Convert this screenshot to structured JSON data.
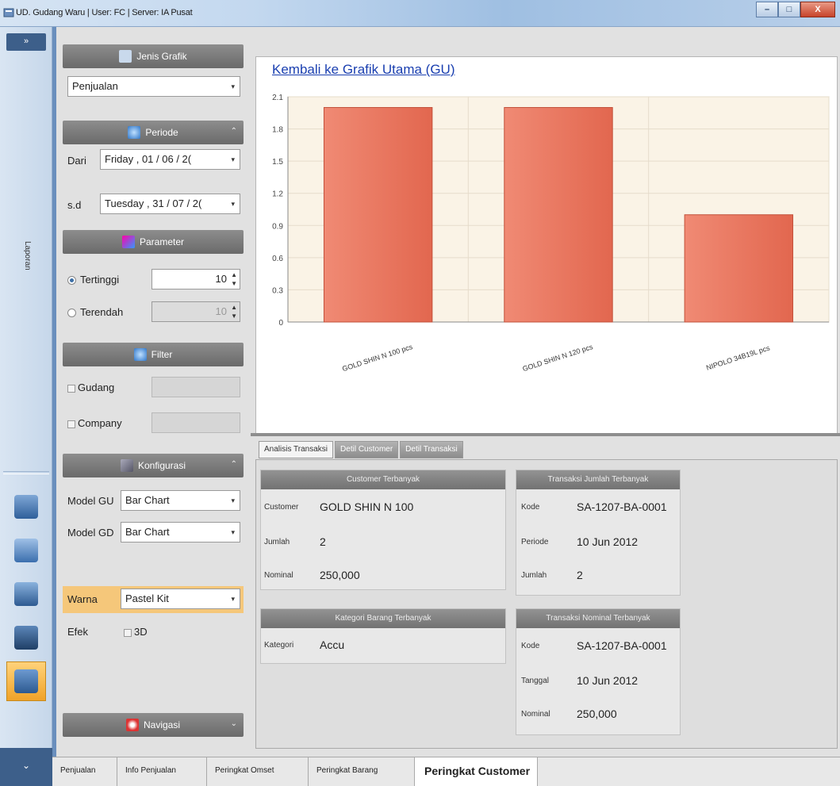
{
  "window": {
    "title": "UD. Gudang Waru  |  User: FC  |  Server: IA Pusat",
    "minimize": "–",
    "maximize": "□",
    "close": "X"
  },
  "leftbar": {
    "top_label": "»",
    "section_label": "Laporan",
    "bottom_label": "⌄",
    "icons": [
      "cash-register-icon",
      "globe-doc-icon",
      "briefcase-icon",
      "folder-icon",
      "report-user-icon"
    ]
  },
  "side": {
    "jenis_grafik": {
      "header": "Jenis Grafik",
      "value": "Penjualan"
    },
    "periode": {
      "header": "Periode",
      "dari_label": "Dari",
      "dari_value": "Friday   , 01 / 06 / 2(",
      "sd_label": "s.d",
      "sd_value": "Tuesday  , 31 / 07 / 2("
    },
    "parameter": {
      "header": "Parameter",
      "tertinggi_label": "Tertinggi",
      "tertinggi_value": "10",
      "terendah_label": "Terendah",
      "terendah_value": "10"
    },
    "filter": {
      "header": "Filter",
      "gudang_label": "Gudang",
      "company_label": "Company"
    },
    "konfigurasi": {
      "header": "Konfigurasi",
      "model_gu_label": "Model GU",
      "model_gu_value": "Bar Chart",
      "model_gd_label": "Model GD",
      "model_gd_value": "Bar Chart",
      "warna_label": "Warna",
      "warna_value": "Pastel Kit",
      "efek_label": "Efek",
      "efek_3d_label": "3D"
    },
    "navigasi": {
      "header": "Navigasi"
    }
  },
  "main": {
    "back_link": "Kembali ke Grafik Utama (GU)",
    "tabs": [
      "Analisis Transaksi",
      "Detil Customer",
      "Detil Transaksi"
    ],
    "cards": {
      "customer_terbanyak": {
        "header": "Customer Terbanyak",
        "rows": [
          {
            "key": "Customer",
            "value": "GOLD SHIN N 100"
          },
          {
            "key": "Jumlah",
            "value": "2"
          },
          {
            "key": "Nominal",
            "value": "250,000"
          }
        ]
      },
      "transaksi_jumlah": {
        "header": "Transaksi Jumlah Terbanyak",
        "rows": [
          {
            "key": "Kode",
            "value": "SA-1207-BA-0001"
          },
          {
            "key": "Periode",
            "value": "10 Jun 2012"
          },
          {
            "key": "Jumlah",
            "value": "2"
          }
        ]
      },
      "kategori_barang": {
        "header": "Kategori Barang Terbanyak",
        "rows": [
          {
            "key": "Kategori",
            "value": "Accu"
          }
        ]
      },
      "transaksi_nominal": {
        "header": "Transaksi Nominal Terbanyak",
        "rows": [
          {
            "key": "Kode",
            "value": "SA-1207-BA-0001"
          },
          {
            "key": "Tanggal",
            "value": "10 Jun 2012"
          },
          {
            "key": "Nominal",
            "value": "250,000"
          }
        ]
      }
    }
  },
  "bottom_tabs": [
    "Penjualan",
    "Info Penjualan",
    "Peringkat Omset",
    "Peringkat Barang",
    "Peringkat Customer"
  ],
  "colors": {
    "bar": "#e2674f",
    "bar_light": "#f08a74",
    "plot_bg": "#faf3e6",
    "link": "#1a3fb0"
  },
  "chart_data": {
    "type": "bar",
    "categories": [
      "GOLD SHIN N 100 pcs",
      "GOLD SHIN N 120 pcs",
      "NIPOLO 34B19L pcs"
    ],
    "values": [
      2,
      2,
      1
    ],
    "yticks": [
      "0",
      "0.3",
      "0.6",
      "0.9",
      "1.2",
      "1.5",
      "1.8",
      "2.1"
    ],
    "ylim": [
      0,
      2.1
    ],
    "grid": true
  }
}
